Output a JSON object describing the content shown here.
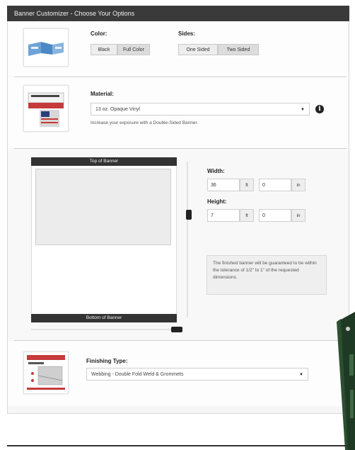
{
  "title": "Banner Customizer - Choose Your Options",
  "color": {
    "label": "Color:",
    "options": [
      "Black",
      "Full Color"
    ]
  },
  "sides": {
    "label": "Sides:",
    "options": [
      "One Sided",
      "Two Sided"
    ]
  },
  "material": {
    "label": "Material:",
    "selected": "13 oz. Opaque Vinyl",
    "hint": "Increase your exposure with a Double-Sided Banner."
  },
  "preview": {
    "top_label": "Top of Banner",
    "bottom_label": "Bottom of Banner"
  },
  "width": {
    "label": "Width:",
    "ft_value": "36",
    "ft_unit": "ft",
    "in_value": "0",
    "in_unit": "in"
  },
  "height": {
    "label": "Height:",
    "ft_value": "7",
    "ft_unit": "ft",
    "in_value": "0",
    "in_unit": "in"
  },
  "tolerance_note": "The finished banner will be guaranteed to be within the tolerance of 1/2\" to 1\" of the requested dimensions.",
  "finishing": {
    "label": "Finishing Type:",
    "selected": "Webbing - Double Fold Weld & Grommets"
  },
  "icons": [
    "info-icon",
    "chevron-down-icon"
  ]
}
